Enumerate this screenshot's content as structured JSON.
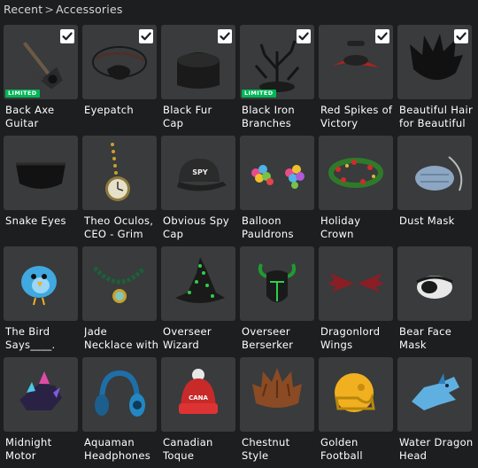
{
  "breadcrumb": {
    "root": "Recent",
    "separator": ">",
    "current": "Accessories"
  },
  "colors": {
    "background": "#1d1e20",
    "tile": "#393b3d",
    "limited_badge": "#02b757"
  },
  "items": [
    {
      "line1": "Back Axe",
      "line2": "Guitar",
      "selected": true,
      "badge": "LIMITED",
      "icon": "axe-guitar-icon"
    },
    {
      "line1": "Eyepatch",
      "line2": "",
      "selected": true,
      "badge": "",
      "icon": "eyepatch-icon"
    },
    {
      "line1": "Black Fur",
      "line2": "Cap",
      "selected": true,
      "badge": "",
      "icon": "fur-cap-icon"
    },
    {
      "line1": "Black Iron",
      "line2": "Branches",
      "selected": true,
      "badge": "LIMITED",
      "icon": "iron-branches-icon"
    },
    {
      "line1": "Red Spikes of",
      "line2": "Victory",
      "selected": true,
      "badge": "",
      "icon": "red-spikes-icon"
    },
    {
      "line1": "Beautiful Hair",
      "line2": "for Beautiful",
      "selected": true,
      "badge": "",
      "icon": "black-hair-icon"
    },
    {
      "line1": "Snake Eyes",
      "line2": "",
      "selected": false,
      "badge": "",
      "icon": "visor-glasses-icon"
    },
    {
      "line1": "Theo Oculos,",
      "line2": "CEO - Grim",
      "selected": false,
      "badge": "",
      "icon": "pocket-watch-icon"
    },
    {
      "line1": "Obvious Spy",
      "line2": "Cap",
      "selected": false,
      "badge": "",
      "icon": "spy-cap-icon"
    },
    {
      "line1": "Balloon",
      "line2": "Pauldrons",
      "selected": false,
      "badge": "",
      "icon": "balloons-icon"
    },
    {
      "line1": "Holiday",
      "line2": "Crown",
      "selected": false,
      "badge": "",
      "icon": "holly-wreath-icon"
    },
    {
      "line1": "Dust Mask",
      "line2": "",
      "selected": false,
      "badge": "",
      "icon": "dust-mask-icon"
    },
    {
      "line1": "The Bird",
      "line2": "Says____.",
      "selected": false,
      "badge": "",
      "icon": "blue-bird-icon"
    },
    {
      "line1": "Jade",
      "line2": "Necklace with",
      "selected": false,
      "badge": "",
      "icon": "jade-necklace-icon"
    },
    {
      "line1": "Overseer",
      "line2": "Wizard",
      "selected": false,
      "badge": "",
      "icon": "wizard-hat-icon"
    },
    {
      "line1": "Overseer",
      "line2": "Berserker",
      "selected": false,
      "badge": "",
      "icon": "berserker-helm-icon"
    },
    {
      "line1": "Dragonlord",
      "line2": "Wings",
      "selected": false,
      "badge": "",
      "icon": "dragon-wings-icon"
    },
    {
      "line1": "Bear Face",
      "line2": "Mask",
      "selected": false,
      "badge": "",
      "icon": "bear-mask-icon"
    },
    {
      "line1": "Midnight",
      "line2": "Motor",
      "selected": false,
      "badge": "",
      "icon": "midnight-motor-icon"
    },
    {
      "line1": "Aquaman",
      "line2": "Headphones",
      "selected": false,
      "badge": "",
      "icon": "headphones-icon"
    },
    {
      "line1": "Canadian",
      "line2": "Toque",
      "selected": false,
      "badge": "",
      "icon": "toque-icon"
    },
    {
      "line1": "Chestnut",
      "line2": "Style",
      "selected": false,
      "badge": "",
      "icon": "chestnut-hair-icon"
    },
    {
      "line1": "Golden",
      "line2": "Football",
      "selected": false,
      "badge": "",
      "icon": "football-helmet-icon"
    },
    {
      "line1": "Water Dragon",
      "line2": "Head",
      "selected": false,
      "badge": "",
      "icon": "water-dragon-icon"
    }
  ],
  "icon_text": {
    "spy_cap": "SPY",
    "toque": "CANA"
  }
}
